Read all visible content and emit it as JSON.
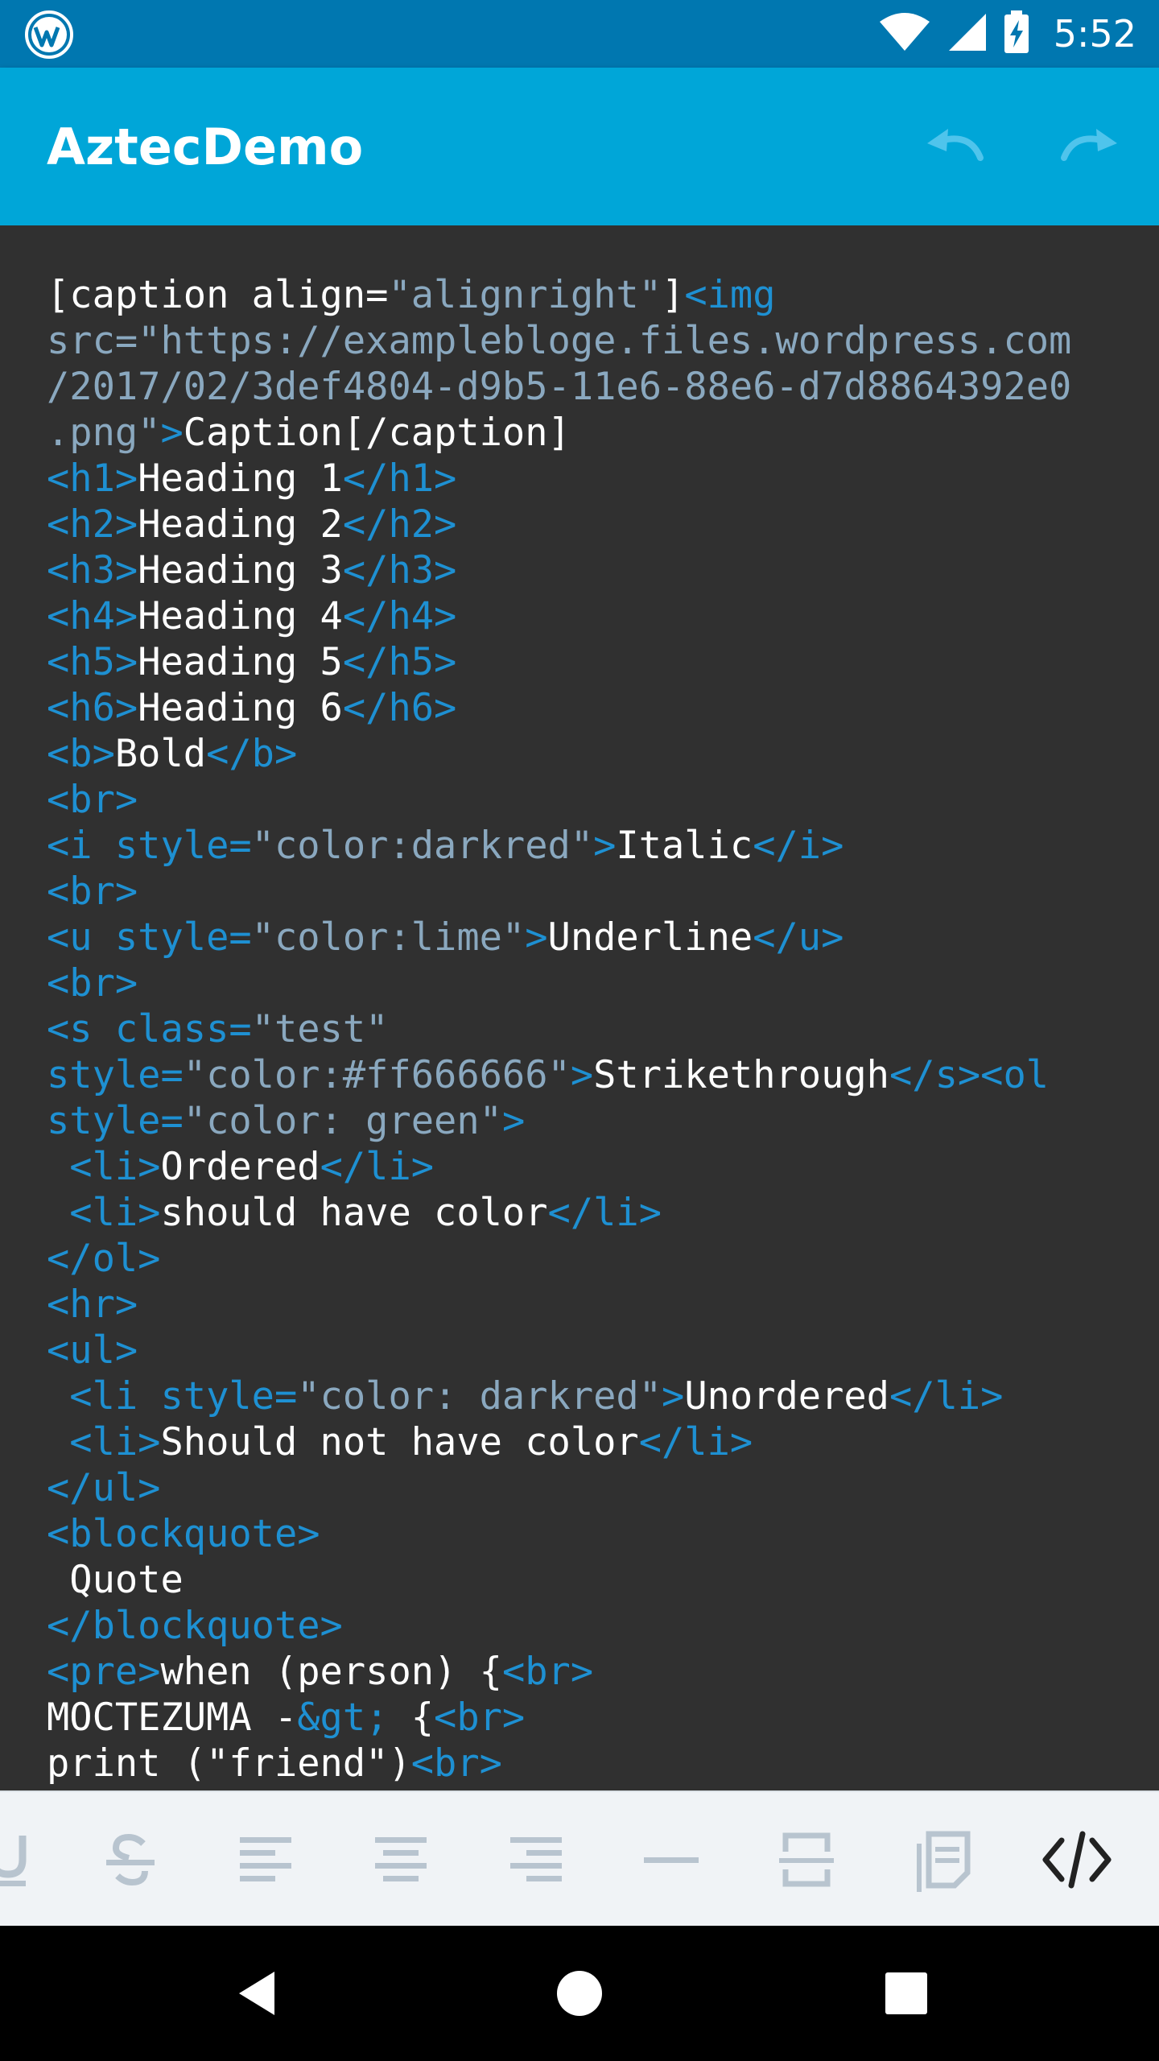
{
  "status_bar": {
    "time": "5:52",
    "icons": [
      "wordpress-icon",
      "wifi-icon",
      "signal-icon",
      "battery-charging-icon"
    ]
  },
  "app_bar": {
    "title": "AztecDemo",
    "actions": [
      "undo-icon",
      "redo-icon"
    ]
  },
  "editor": {
    "lines": [
      [
        [
          "t",
          "[caption align="
        ],
        [
          "a",
          "\"alignright\""
        ],
        [
          "t",
          "]"
        ],
        [
          "g",
          "<img"
        ]
      ],
      [
        [
          "a",
          "src=\"https://examplebloge.files.wordpress.com"
        ]
      ],
      [
        [
          "a",
          "/2017/02/3def4804-d9b5-11e6-88e6-d7d8864392e0"
        ]
      ],
      [
        [
          "a",
          ".png\""
        ],
        [
          "g",
          ">"
        ],
        [
          "t",
          "Caption[/caption]"
        ]
      ],
      [
        [
          "g",
          "<h1>"
        ],
        [
          "t",
          "Heading 1"
        ],
        [
          "g",
          "</h1>"
        ]
      ],
      [
        [
          "g",
          "<h2>"
        ],
        [
          "t",
          "Heading 2"
        ],
        [
          "g",
          "</h2>"
        ]
      ],
      [
        [
          "g",
          "<h3>"
        ],
        [
          "t",
          "Heading 3"
        ],
        [
          "g",
          "</h3>"
        ]
      ],
      [
        [
          "g",
          "<h4>"
        ],
        [
          "t",
          "Heading 4"
        ],
        [
          "g",
          "</h4>"
        ]
      ],
      [
        [
          "g",
          "<h5>"
        ],
        [
          "t",
          "Heading 5"
        ],
        [
          "g",
          "</h5>"
        ]
      ],
      [
        [
          "g",
          "<h6>"
        ],
        [
          "t",
          "Heading 6"
        ],
        [
          "g",
          "</h6>"
        ]
      ],
      [
        [
          "g",
          "<b>"
        ],
        [
          "t",
          "Bold"
        ],
        [
          "g",
          "</b>"
        ]
      ],
      [
        [
          "g",
          "<br>"
        ]
      ],
      [
        [
          "g",
          "<i style="
        ],
        [
          "a",
          "\"color:darkred\""
        ],
        [
          "g",
          ">"
        ],
        [
          "t",
          "Italic"
        ],
        [
          "g",
          "</i>"
        ]
      ],
      [
        [
          "g",
          "<br>"
        ]
      ],
      [
        [
          "g",
          "<u style="
        ],
        [
          "a",
          "\"color:lime\""
        ],
        [
          "g",
          ">"
        ],
        [
          "t",
          "Underline"
        ],
        [
          "g",
          "</u>"
        ]
      ],
      [
        [
          "g",
          "<br>"
        ]
      ],
      [
        [
          "g",
          "<s class="
        ],
        [
          "a",
          "\"test\""
        ]
      ],
      [
        [
          "g",
          "style="
        ],
        [
          "a",
          "\"color:#ff666666\""
        ],
        [
          "g",
          ">"
        ],
        [
          "t",
          "Strikethrough"
        ],
        [
          "g",
          "</s><ol"
        ]
      ],
      [
        [
          "g",
          "style="
        ],
        [
          "a",
          "\"color: green\""
        ],
        [
          "g",
          ">"
        ]
      ],
      [
        [
          "g",
          " <li>"
        ],
        [
          "t",
          "Ordered"
        ],
        [
          "g",
          "</li>"
        ]
      ],
      [
        [
          "g",
          " <li>"
        ],
        [
          "t",
          "should have color"
        ],
        [
          "g",
          "</li>"
        ]
      ],
      [
        [
          "g",
          "</ol>"
        ]
      ],
      [
        [
          "g",
          "<hr>"
        ]
      ],
      [
        [
          "g",
          "<ul>"
        ]
      ],
      [
        [
          "g",
          " <li style="
        ],
        [
          "a",
          "\"color: darkred\""
        ],
        [
          "g",
          ">"
        ],
        [
          "t",
          "Unordered"
        ],
        [
          "g",
          "</li>"
        ]
      ],
      [
        [
          "g",
          " <li>"
        ],
        [
          "t",
          "Should not have color"
        ],
        [
          "g",
          "</li>"
        ]
      ],
      [
        [
          "g",
          "</ul>"
        ]
      ],
      [
        [
          "g",
          "<blockquote>"
        ]
      ],
      [
        [
          "t",
          " Quote"
        ]
      ],
      [
        [
          "g",
          "</blockquote>"
        ]
      ],
      [
        [
          "g",
          "<pre>"
        ],
        [
          "t",
          "when (person) {"
        ],
        [
          "g",
          "<br>"
        ]
      ],
      [
        [
          "t",
          "MOCTEZUMA -"
        ],
        [
          "g",
          "&gt;"
        ],
        [
          "t",
          " {"
        ],
        [
          "g",
          "<br>"
        ]
      ],
      [
        [
          "t",
          "print (\"friend\")"
        ],
        [
          "g",
          "<br>"
        ]
      ]
    ]
  },
  "format_toolbar": {
    "tools": [
      "underline-icon",
      "strikethrough-icon",
      "align-left-icon",
      "align-center-icon",
      "align-right-icon",
      "horizontal-rule-icon",
      "more-icon",
      "page-break-icon",
      "html-source-icon"
    ],
    "active_tool": "html-source-icon"
  },
  "nav_bar": {
    "buttons": [
      "back-icon",
      "home-icon",
      "recents-icon"
    ]
  },
  "colors": {
    "status_bar": "#0077b0",
    "app_bar": "#00a6d8",
    "editor_bg": "#303030",
    "tag": "#1e90d2",
    "attr": "#8aa8bf",
    "text": "#ffffff",
    "toolbar_bg": "#f0f3f6",
    "toolbar_icon": "#b8c4cf"
  }
}
